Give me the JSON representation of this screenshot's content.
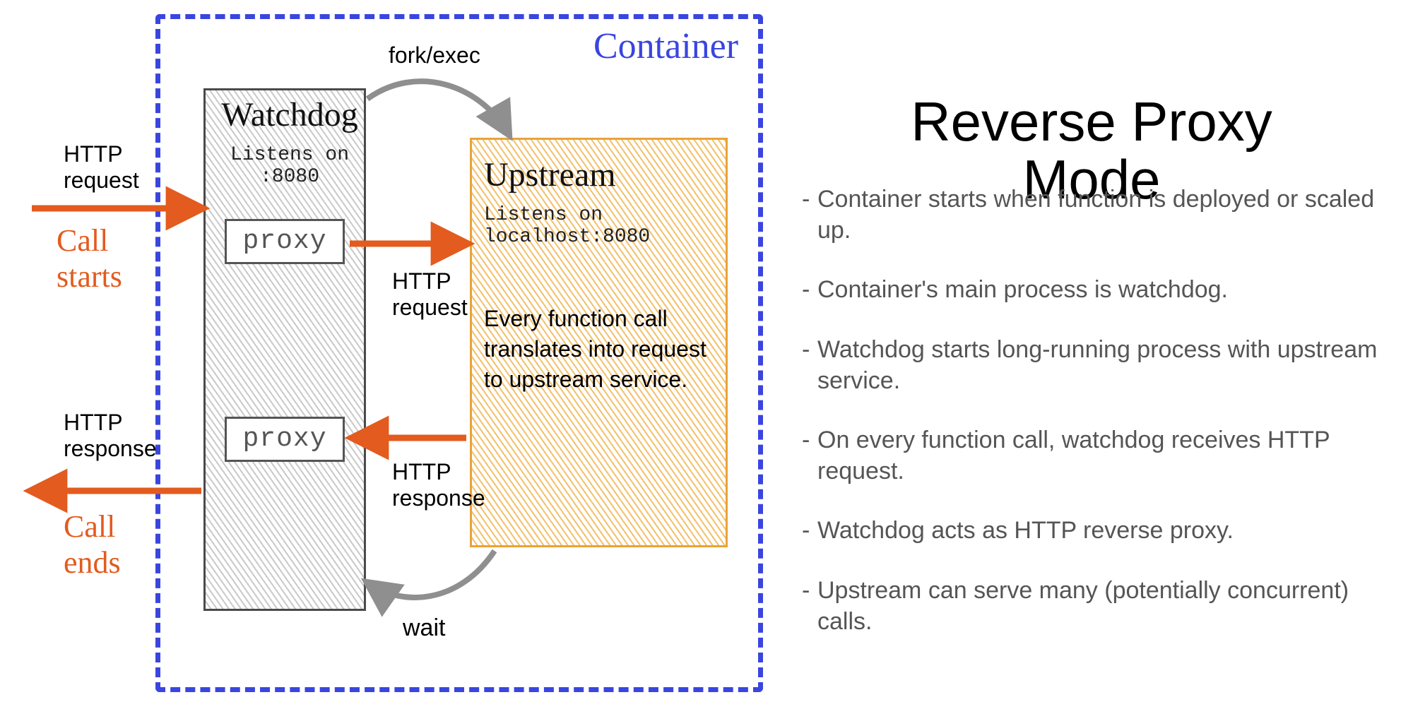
{
  "title": "Reverse Proxy Mode",
  "container_label": "Container",
  "watchdog": {
    "title": "Watchdog",
    "listens": "Listens on\n:8080"
  },
  "upstream": {
    "title": "Upstream",
    "listens": "Listens on\nlocalhost:8080",
    "description": "Every function call translates into request to upstream service."
  },
  "proxy_label": "proxy",
  "labels": {
    "fork_exec": "fork/exec",
    "wait": "wait",
    "http_request": "HTTP\nrequest",
    "http_response": "HTTP\nresponse",
    "call_starts": "Call\nstarts",
    "call_ends": "Call\nends",
    "mid_http_request": "HTTP\nrequest",
    "mid_http_response": "HTTP\nresponse"
  },
  "bullets": [
    "Container starts when function is deployed or scaled up.",
    "Container's main process is watchdog.",
    "Watchdog starts long-running process with upstream service.",
    "On every function call, watchdog receives HTTP request.",
    "Watchdog acts as HTTP reverse proxy.",
    "Upstream can serve many (potentially concurrent) calls."
  ]
}
